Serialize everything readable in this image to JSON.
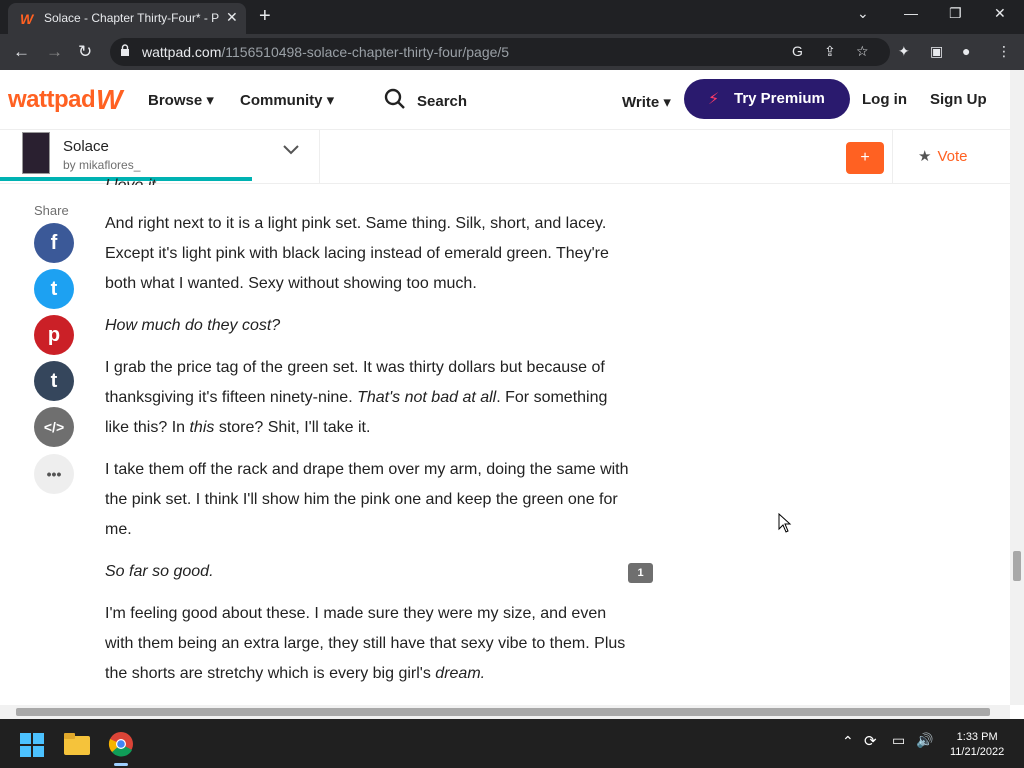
{
  "browser": {
    "tab_title": "Solace - Chapter Thirty-Four* - P",
    "url_host": "wattpad.com",
    "url_path": "/1156510498-solace-chapter-thirty-four/page/5"
  },
  "header": {
    "logo": "wattpad",
    "browse": "Browse",
    "community": "Community",
    "search": "Search",
    "write": "Write",
    "premium": "Try Premium",
    "login": "Log in",
    "signup": "Sign Up"
  },
  "storybar": {
    "title": "Solace",
    "author": "by mikaflores_",
    "add": "+",
    "vote": "Vote",
    "cover_text": "Solace",
    "progress_fraction": 0.246
  },
  "share": {
    "label": "Share",
    "buttons": [
      {
        "name": "facebook",
        "glyph": "f",
        "color": "#3b5998"
      },
      {
        "name": "twitter",
        "glyph": "t",
        "color": "#1da1f2"
      },
      {
        "name": "pinterest",
        "glyph": "p",
        "color": "#cb2027"
      },
      {
        "name": "tumblr",
        "glyph": "t",
        "color": "#35465c"
      },
      {
        "name": "embed",
        "glyph": "</>",
        "color": "#6f6f6f"
      },
      {
        "name": "more",
        "glyph": "•••",
        "color": "#eeeeee"
      }
    ]
  },
  "story": {
    "cut_line": "I love it.",
    "p1": "And right next to it is a light pink set. Same thing. Silk, short, and lacey. Except it's light pink with black lacing instead of emerald green. They're both what I wanted. Sexy without showing too much.",
    "p2": "How much do they cost?",
    "p3a": "I grab the price tag of the green set. It was thirty dollars but because of thanksgiving it's fifteen ninety-nine. ",
    "p3b": "That's not bad at all",
    "p3c": ". For something like this? In ",
    "p3d": "this",
    "p3e": " store? Shit, I'll take it.",
    "p4": "I take them off the rack and drape them over my arm, doing the same with the pink set. I think I'll show him the pink one and keep the green one for me.",
    "p5": "So far so good.",
    "p6a": "I'm feeling good about these. I made sure they were my size, and even with them being an extra large, they still have that sexy vibe to them. Plus the shorts are stretchy which is every big girl's ",
    "p6b": "dream.",
    "comment_count": "1"
  },
  "taskbar": {
    "time": "1:33 PM",
    "date": "11/21/2022"
  },
  "colors": {
    "brand": "#ff6122",
    "premium_bg": "#2a1a6e",
    "progress": "#00b2b2"
  }
}
